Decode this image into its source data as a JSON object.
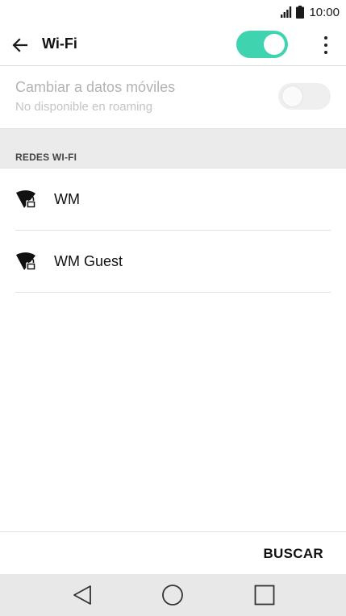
{
  "status_bar": {
    "time": "10:00",
    "icons": [
      "signal-icon",
      "battery-icon"
    ]
  },
  "app_bar": {
    "back_icon": "arrow-left-icon",
    "title": "Wi-Fi",
    "wifi_toggle_on": true,
    "toggle_color": "#3fd3b0",
    "more_icon": "more-vert-icon"
  },
  "mobile_data_switch": {
    "title": "Cambiar a datos móviles",
    "subtitle": "No disponible en roaming",
    "enabled": false
  },
  "section": {
    "label": "REDES WI-FI"
  },
  "networks": [
    {
      "name": "WM",
      "icon": "wifi-lock-icon"
    },
    {
      "name": "WM Guest",
      "icon": "wifi-lock-icon"
    }
  ],
  "bottom_action": {
    "scan_label": "BUSCAR"
  },
  "nav_bar": {
    "icons": [
      "nav-back-icon",
      "nav-home-icon",
      "nav-recents-icon"
    ]
  }
}
